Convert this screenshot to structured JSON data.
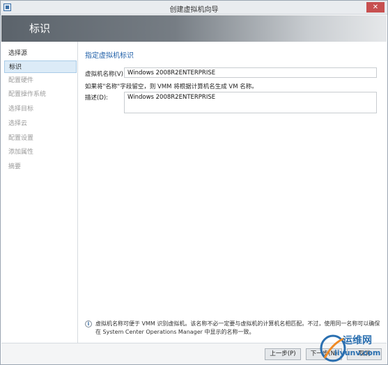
{
  "window": {
    "title": "创建虚拟机向导",
    "close_glyph": "✕"
  },
  "header": {
    "title": "标识"
  },
  "sidebar": {
    "items": [
      {
        "label": "选择源",
        "state": "done"
      },
      {
        "label": "标识",
        "state": "active"
      },
      {
        "label": "配置硬件",
        "state": "pending"
      },
      {
        "label": "配置操作系统",
        "state": "pending"
      },
      {
        "label": "选择目标",
        "state": "pending"
      },
      {
        "label": "选择云",
        "state": "pending"
      },
      {
        "label": "配置设置",
        "state": "pending"
      },
      {
        "label": "添加属性",
        "state": "pending"
      },
      {
        "label": "摘要",
        "state": "pending"
      }
    ]
  },
  "main": {
    "section_title": "指定虚拟机标识",
    "vm_name_label": "虚拟机名称(V):",
    "vm_name_value": "Windows 2008R2ENTERPRISE",
    "name_hint": "如果将\"名称\"字段留空，则 VMM 将根据计算机名生成 VM 名称。",
    "description_label": "描述(D):",
    "description_value": "Windows 2008R2ENTERPRISE",
    "info_text": "虚拟机名称可便于 VMM 识别虚拟机。该名称不必一定要与虚拟机的计算机名相匹配。不过，使用同一名称可以确保在 System Center Operations Manager 中显示的名称一致。"
  },
  "footer": {
    "prev_label": "上一步(P)",
    "next_label": "下一步(N)",
    "cancel_label": "取消"
  },
  "watermark": {
    "text": "运维网",
    "url": "iiyunv.com"
  },
  "colors": {
    "accent": "#1f5fa8",
    "active_nav": "#dcebf7",
    "header_dark": "#5b636b"
  }
}
